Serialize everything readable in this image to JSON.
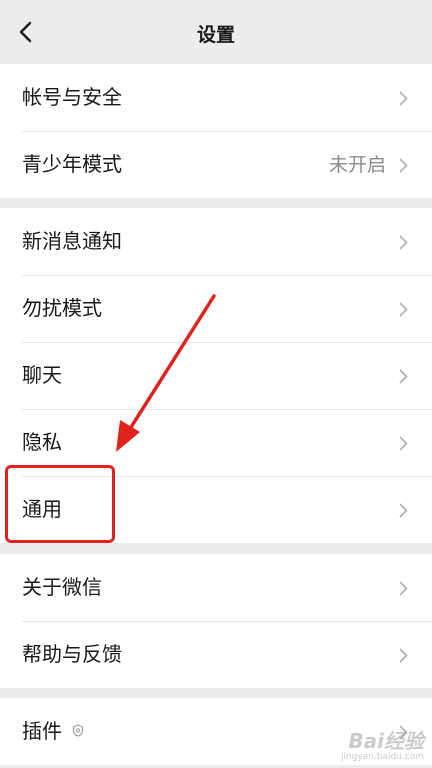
{
  "header": {
    "title": "设置",
    "back_icon": "chevron-left-icon"
  },
  "groups": [
    {
      "items": [
        {
          "label": "帐号与安全",
          "value": ""
        },
        {
          "label": "青少年模式",
          "value": "未开启"
        }
      ]
    },
    {
      "items": [
        {
          "label": "新消息通知",
          "value": ""
        },
        {
          "label": "勿扰模式",
          "value": ""
        },
        {
          "label": "聊天",
          "value": ""
        },
        {
          "label": "隐私",
          "value": ""
        },
        {
          "label": "通用",
          "value": "",
          "highlighted": true
        }
      ]
    },
    {
      "items": [
        {
          "label": "关于微信",
          "value": ""
        },
        {
          "label": "帮助与反馈",
          "value": ""
        }
      ]
    },
    {
      "items": [
        {
          "label": "插件",
          "value": "",
          "icon": "plugin-shield-icon"
        }
      ]
    }
  ],
  "annotation": {
    "highlight_color": "#e0221c"
  },
  "watermark": {
    "logo": "Bai经验",
    "url": "jingyan.baidu.com"
  }
}
